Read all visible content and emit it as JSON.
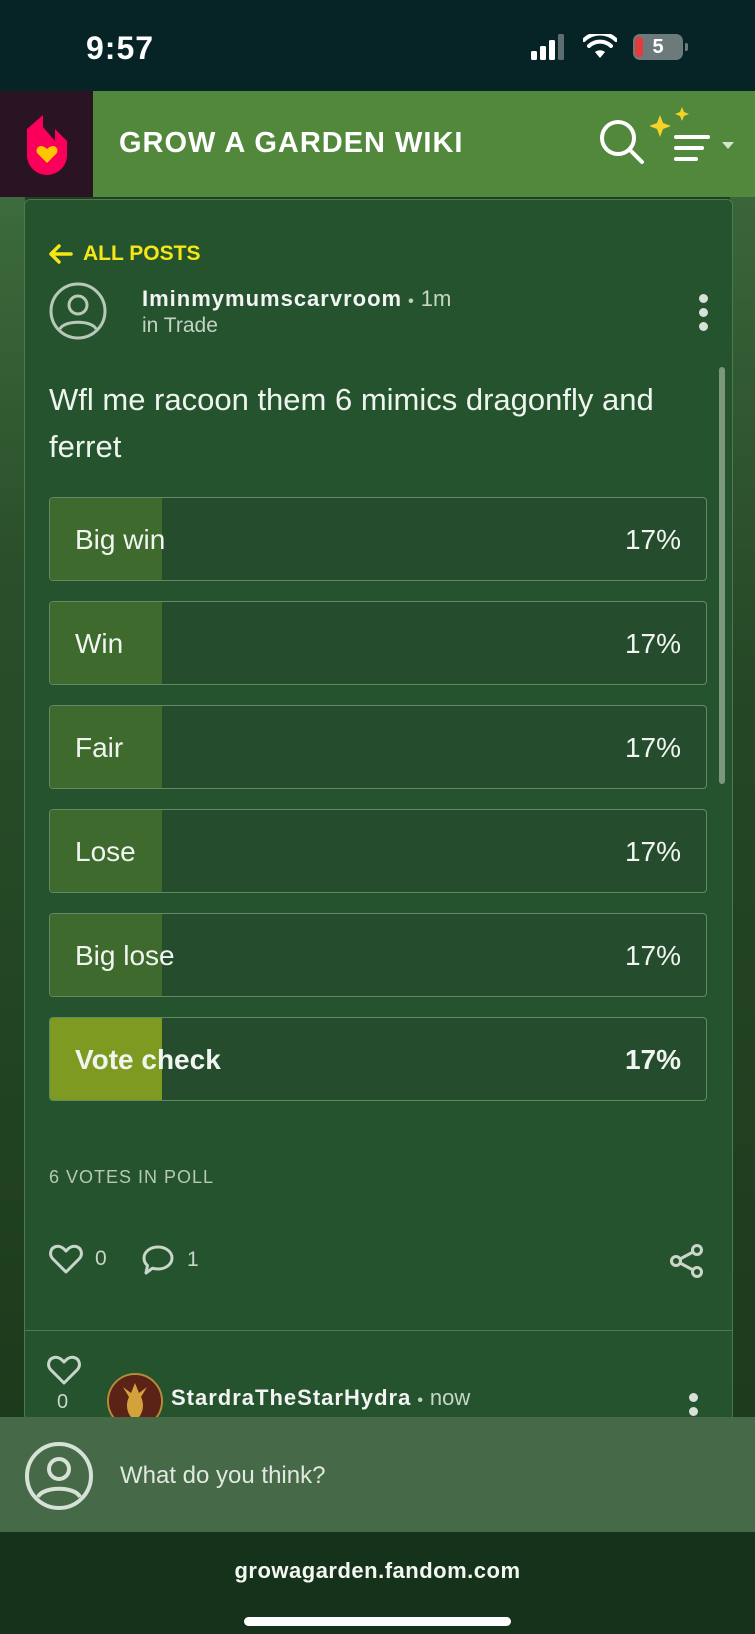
{
  "status_bar": {
    "time": "9:57",
    "battery": "5"
  },
  "header": {
    "title": "GROW A GARDEN WIKI"
  },
  "post": {
    "back_label": "ALL POSTS",
    "author": "Iminmymumscarvroom",
    "time": "1m",
    "category": "in Trade",
    "title": "Wfl me racoon them 6 mimics dragonfly and ferret"
  },
  "poll": {
    "options": [
      {
        "label": "Big win",
        "percent": "17%",
        "share": 0.17,
        "voted": false
      },
      {
        "label": "Win",
        "percent": "17%",
        "share": 0.17,
        "voted": false
      },
      {
        "label": "Fair",
        "percent": "17%",
        "share": 0.17,
        "voted": false
      },
      {
        "label": "Lose",
        "percent": "17%",
        "share": 0.17,
        "voted": false
      },
      {
        "label": "Big lose",
        "percent": "17%",
        "share": 0.17,
        "voted": false
      },
      {
        "label": "Vote check",
        "percent": "17%",
        "share": 0.17,
        "voted": true
      }
    ],
    "votes_label": "6 VOTES IN POLL"
  },
  "actions": {
    "likes": "0",
    "comments": "1"
  },
  "reply": {
    "author": "StardraTheStarHydra",
    "time": "now",
    "likes": "0"
  },
  "comment_box": {
    "placeholder": "What do you think?"
  },
  "browser": {
    "url": "growagarden.fandom.com"
  },
  "colors": {
    "header": "#52883c",
    "card": "#25532e",
    "accent": "#f5e615",
    "voted": "#7f9a20",
    "fill": "#3e6a2d"
  }
}
